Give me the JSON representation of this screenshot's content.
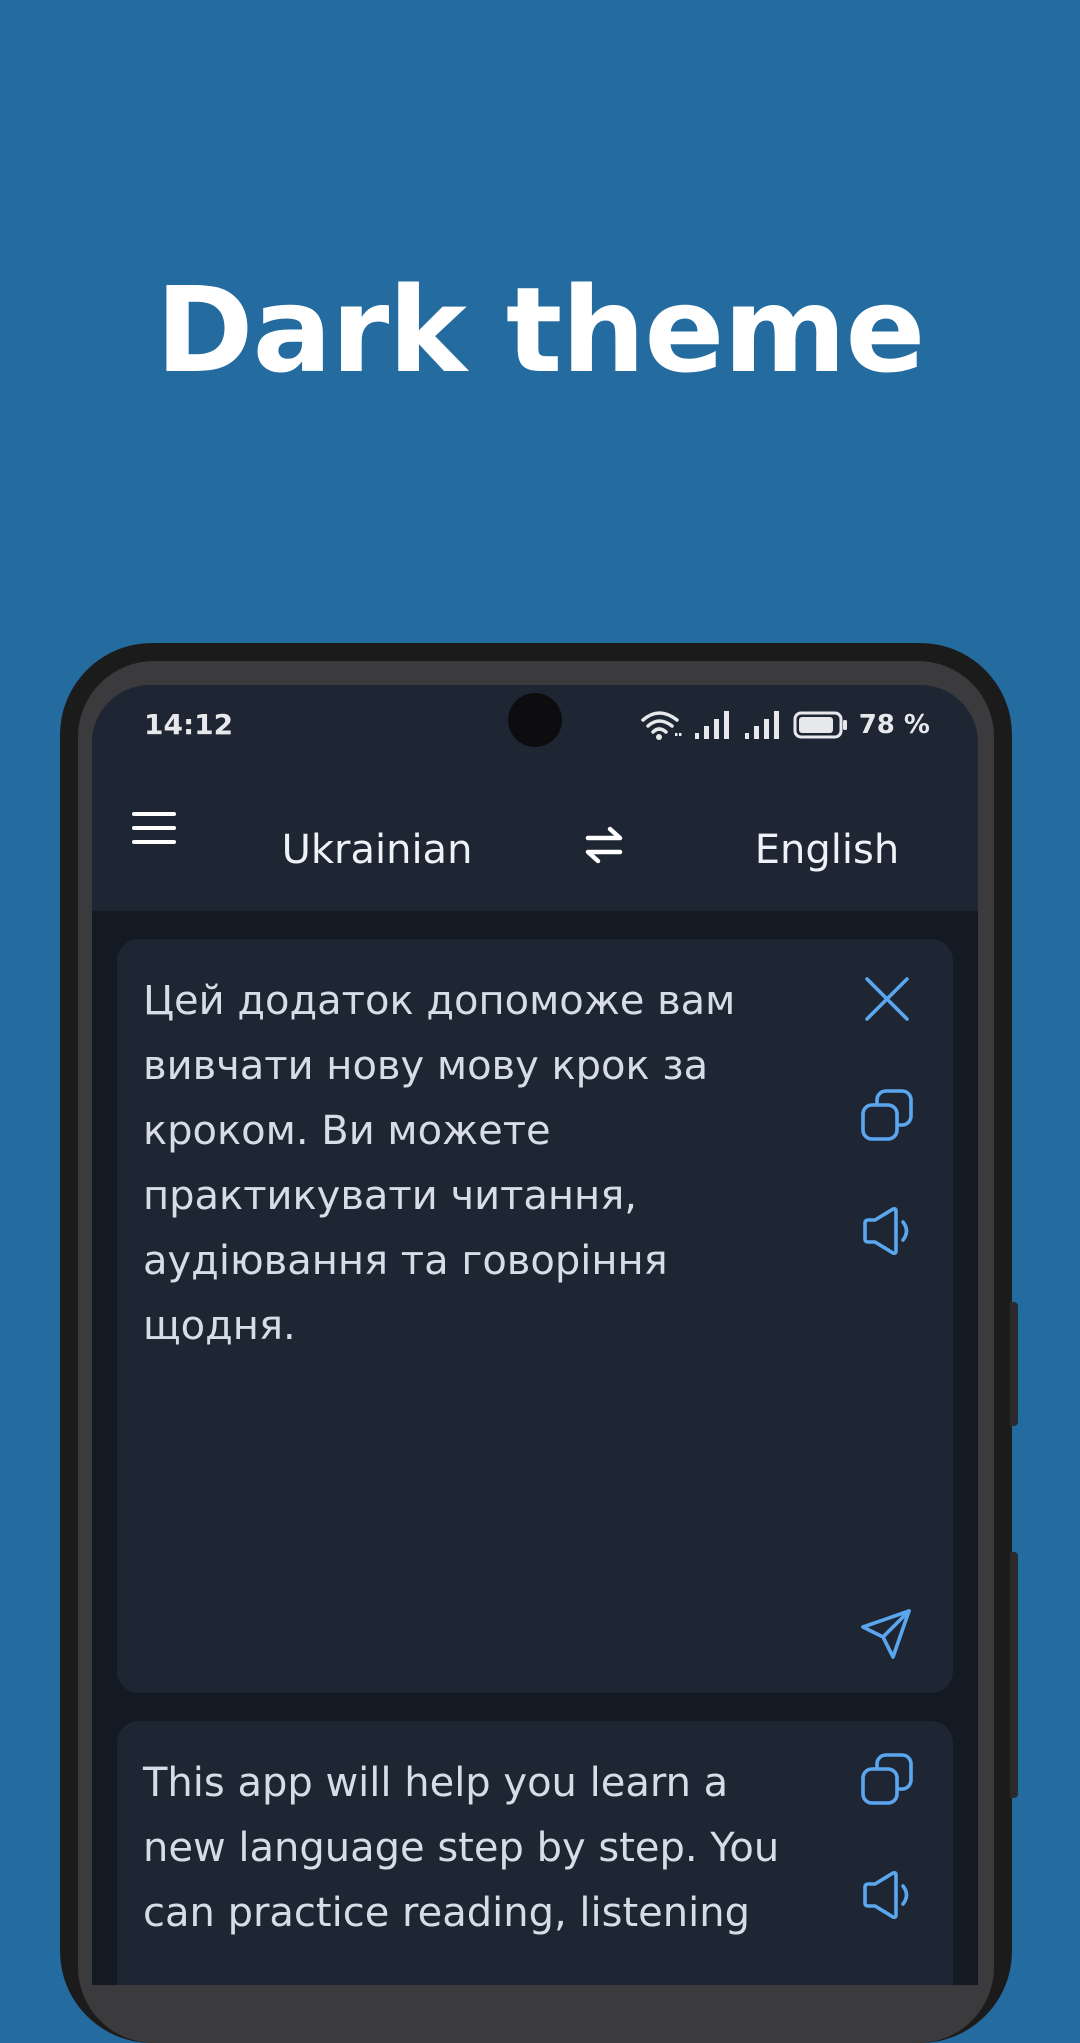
{
  "promo": {
    "headline": "Dark theme"
  },
  "status_bar": {
    "time": "14:12",
    "battery": "78 %"
  },
  "toolbar": {
    "source_language": "Ukrainian",
    "target_language": "English"
  },
  "source_card": {
    "text": "Цей додаток допоможе вам вивчати нову мову крок за кроком. Ви можете практикувати читання, аудіювання та говоріння щодня."
  },
  "target_card": {
    "text": "This app will help you learn a new language step by step. You can practice reading, listening"
  },
  "icons": {
    "menu": "hamburger-icon",
    "swap": "swap-arrows-icon",
    "clear": "close-icon",
    "copy": "copy-icon",
    "speak": "speaker-icon",
    "send": "send-icon"
  },
  "colors": {
    "background": "#246BA0",
    "app_bar": "#1e2633",
    "screen": "#131a23",
    "accent": "#5aa7f0"
  }
}
